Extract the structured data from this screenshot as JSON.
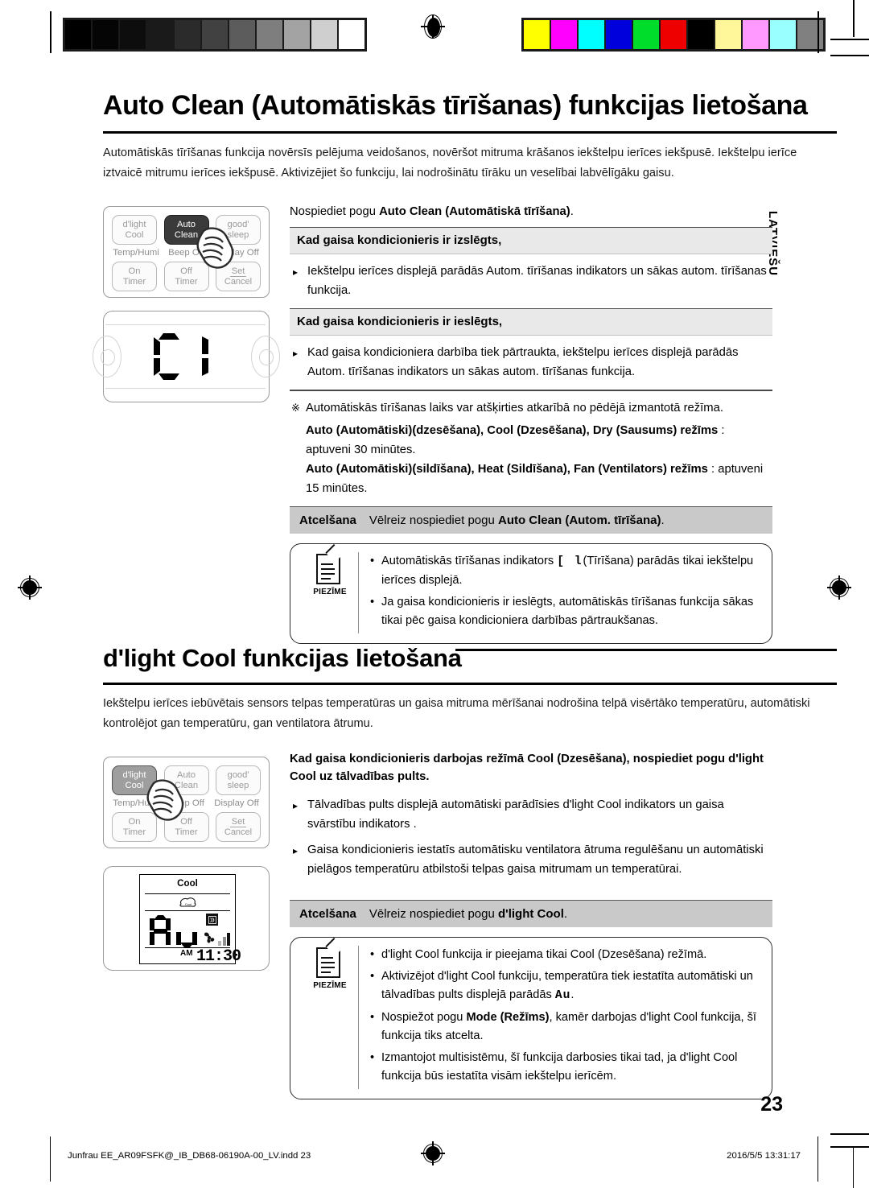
{
  "calibration": {
    "gray_swatches": [
      "#000000",
      "#050505",
      "#0d0d0d",
      "#1a1a1a",
      "#2b2b2b",
      "#414141",
      "#5c5c5c",
      "#7e7e7e",
      "#a3a3a3",
      "#cfcfcf",
      "#ffffff"
    ],
    "color_swatches": [
      "#ffff00",
      "#ff00ff",
      "#00ffff",
      "#0000dd",
      "#00dd2a",
      "#ee0000",
      "#000000",
      "#fff799",
      "#ff99ff",
      "#99ffff",
      "#808080"
    ],
    "registration_mark": "registration-target-icon"
  },
  "side_tab": "LATVIEŠU",
  "section1": {
    "title": "Auto Clean (Automātiskās tīrīšanas) funkcijas lietošana",
    "intro": "Automātiskās tīrīšanas funkcija novērsīs pelējuma veidošanos, novēršot mitruma krāšanos iekštelpu ierīces iekšpusē. Iekštelpu ierīce iztvaicē mitrumu ierīces iekšpusē. Aktivizējiet šo funkciju, lai nodrošinātu tīrāku un veselībai labvēlīgāku gaisu.",
    "remote": {
      "buttons_row1": [
        "d'light\nCool",
        "Auto\nClean",
        "good'\nsleep"
      ],
      "btn_dlight_line1": "d'light",
      "btn_dlight_line2": "Cool",
      "btn_autoclean_line1": "Auto",
      "btn_autoclean_line2": "Clean",
      "btn_goodsleep_line1": "good'",
      "btn_goodsleep_line2": "sleep",
      "sublabels": [
        "Temp/Humi",
        "Beep Off",
        "Display Off"
      ],
      "btn_ontimer_line1": "On",
      "btn_ontimer_line2": "Timer",
      "btn_offtimer_line1": "Off",
      "btn_offtimer_line2": "Timer",
      "btn_set": "Set",
      "btn_cancel": "Cancel",
      "active_button": "Auto Clean",
      "pointer": "hand-pointer-icon"
    },
    "display": {
      "indicator": "CI",
      "description": "seven-segment-display"
    },
    "lead_head_plain": "Nospiediet pogu ",
    "lead_head_bold": "Auto Clean (Automātiskā tīrīšana)",
    "lead_head_tail": ".",
    "band_off": "Kad gaisa kondicionieris ir izslēgts,",
    "bullet_off": "Iekštelpu ierīces displejā parādās Autom. tīrīšanas indikators un sākas autom. tīrīšanas funkcija.",
    "band_on": "Kad gaisa kondicionieris ir ieslēgts,",
    "bullet_on": "Kad gaisa kondicioniera darbība tiek pārtraukta, iekštelpu ierīces displejā parādās Autom. tīrīšanas indikators un sākas autom. tīrīšanas funkcija.",
    "asterisk_mark": "※",
    "asterisk_note": "Automātiskās tīrīšanas laiks var atšķirties atkarībā no pēdējā izmantotā režīma.",
    "mode_line1_bold": "Auto (Automātiski)(dzesēšana), Cool (Dzesēšana), Dry (Sausums) režīms",
    "mode_line1_rest": " : aptuveni 30 minūtes.",
    "mode_line2_bold": "Auto (Automātiski)(sildīšana), Heat (Sildīšana), Fan (Ventilators) režīms",
    "mode_line2_rest": " : aptuveni 15 minūtes.",
    "cancel_label": "Atcelšana",
    "cancel_text_plain": "Vēlreiz nospiediet pogu ",
    "cancel_text_bold": "Auto Clean (Autom. tīrīšana)",
    "cancel_text_tail": ".",
    "note_label": "PIEZĪME",
    "note_icon": "document-note-icon",
    "note_items": [
      {
        "pre": "Automātiskās tīrīšanas indikators ",
        "glyph": "CI",
        "post": "(Tīrīšana) parādās tikai iekštelpu ierīces displejā."
      },
      {
        "pre": "Ja gaisa kondicionieris ir ieslēgts, automātiskās tīrīšanas funkcija sākas tikai pēc gaisa kondicioniera darbības pārtraukšanas.",
        "glyph": "",
        "post": ""
      }
    ]
  },
  "section2": {
    "title": "d'light Cool funkcijas lietošana",
    "intro": "Iekštelpu ierīces iebūvētais sensors telpas temperatūras un gaisa mitruma mērīšanai nodrošina telpā visērtāko temperatūru, automātiski kontrolējot gan temperatūru, gan ventilatora ātrumu.",
    "remote": {
      "btn_dlight_line1": "d'light",
      "btn_dlight_line2": "Cool",
      "btn_autoclean_line1": "Auto",
      "btn_autoclean_line2": "Clean",
      "btn_goodsleep_line1": "good'",
      "btn_goodsleep_line2": "sleep",
      "sublabels": [
        "Temp/Humi",
        "Beep Off",
        "Display Off"
      ],
      "btn_ontimer_line1": "On",
      "btn_ontimer_line2": "Timer",
      "btn_offtimer_line1": "Off",
      "btn_offtimer_line2": "Timer",
      "btn_set": "Set",
      "btn_cancel": "Cancel",
      "active_button": "d'light Cool",
      "pointer": "hand-pointer-icon"
    },
    "lcd": {
      "mode_label": "Cool",
      "dlight_icon": "dlight-cool-icon",
      "segment_text": "Au",
      "swing_icon": "air-swing-icon",
      "fan_icon": "fan-icon",
      "fan_bars": 3,
      "meridiem": "AM",
      "time": "11:30"
    },
    "lead_head_a": "Kad gaisa kondicionieris darbojas režīmā Cool (Dzesēšana), nospiediet pogu ",
    "lead_head_b": "d'light Cool",
    "lead_head_c": " uz tālvadības pults.",
    "bullet1": "Tālvadības pults displejā automātiski parādīsies d'light Cool indikators un gaisa svārstību indikators .",
    "bullet2": "Gaisa kondicionieris iestatīs automātisku ventilatora ātruma regulēšanu un automātiski pielāgos temperatūru atbilstoši telpas gaisa mitrumam un temperatūrai.",
    "cancel_label": "Atcelšana",
    "cancel_text_plain": "Vēlreiz nospiediet pogu ",
    "cancel_text_bold": "d'light Cool",
    "cancel_text_tail": ".",
    "note_label": "PIEZĪME",
    "note_icon": "document-note-icon",
    "note_items": [
      {
        "pre": "d'light Cool funkcija ir pieejama tikai Cool (Dzesēšana) režīmā.",
        "mid": "",
        "post": ""
      },
      {
        "pre": "Aktivizējot d'light Cool funkciju, temperatūra tiek iestatīta automātiski un tālvadības pults displejā parādās ",
        "mid": "Au",
        "post": "."
      },
      {
        "pre": "Nospiežot pogu ",
        "mid": "Mode (Režīms)",
        "post": ", kamēr darbojas d'light Cool funkcija, šī funkcija tiks atcelta."
      },
      {
        "pre": "Izmantojot multisistēmu, šī funkcija darbosies tikai tad, ja d'light Cool funkcija būs iestatīta visām iekštelpu ierīcēm.",
        "mid": "",
        "post": ""
      }
    ]
  },
  "footer": {
    "page_number": "23",
    "file_info": "Junfrau EE_AR09FSFK@_IB_DB68-06190A-00_LV.indd   23",
    "timestamp": "2016/5/5   13:31:17"
  }
}
